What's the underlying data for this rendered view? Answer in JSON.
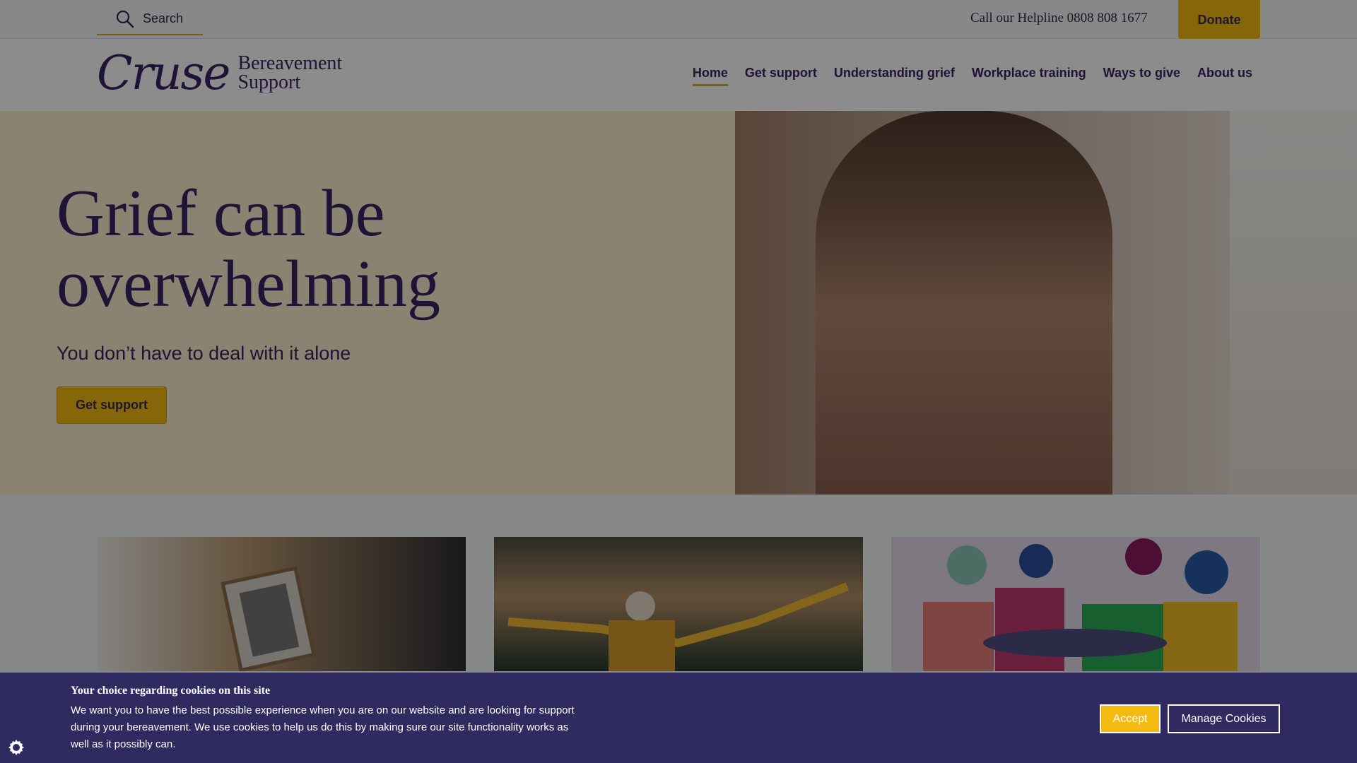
{
  "top": {
    "search_label": "Search",
    "helpline": "Call our Helpline 0808 808 1677",
    "donate_label": "Donate"
  },
  "brand": {
    "logo_script": "Cruse",
    "logo_line1": "Bereavement",
    "logo_line2": "Support"
  },
  "nav": [
    "Home",
    "Get support",
    "Understanding grief",
    "Workplace training",
    "Ways to give",
    "About us"
  ],
  "hero": {
    "title_line1": "Grief can be",
    "title_line2": "overwhelming",
    "subtitle": "You don’t have to deal with it alone",
    "button_label": "Get support"
  },
  "cookie": {
    "title": "Your choice regarding cookies on this site",
    "text": "We want you to have the best possible experience when you are on our website and are looking for support during your bereavement. We use cookies to help us do this by making sure our site functionality works as well as it possibly can.",
    "accept_label": "Accept",
    "manage_label": "Manage Cookies"
  },
  "icons": {
    "search": "search-icon",
    "settings": "gear-icon"
  }
}
